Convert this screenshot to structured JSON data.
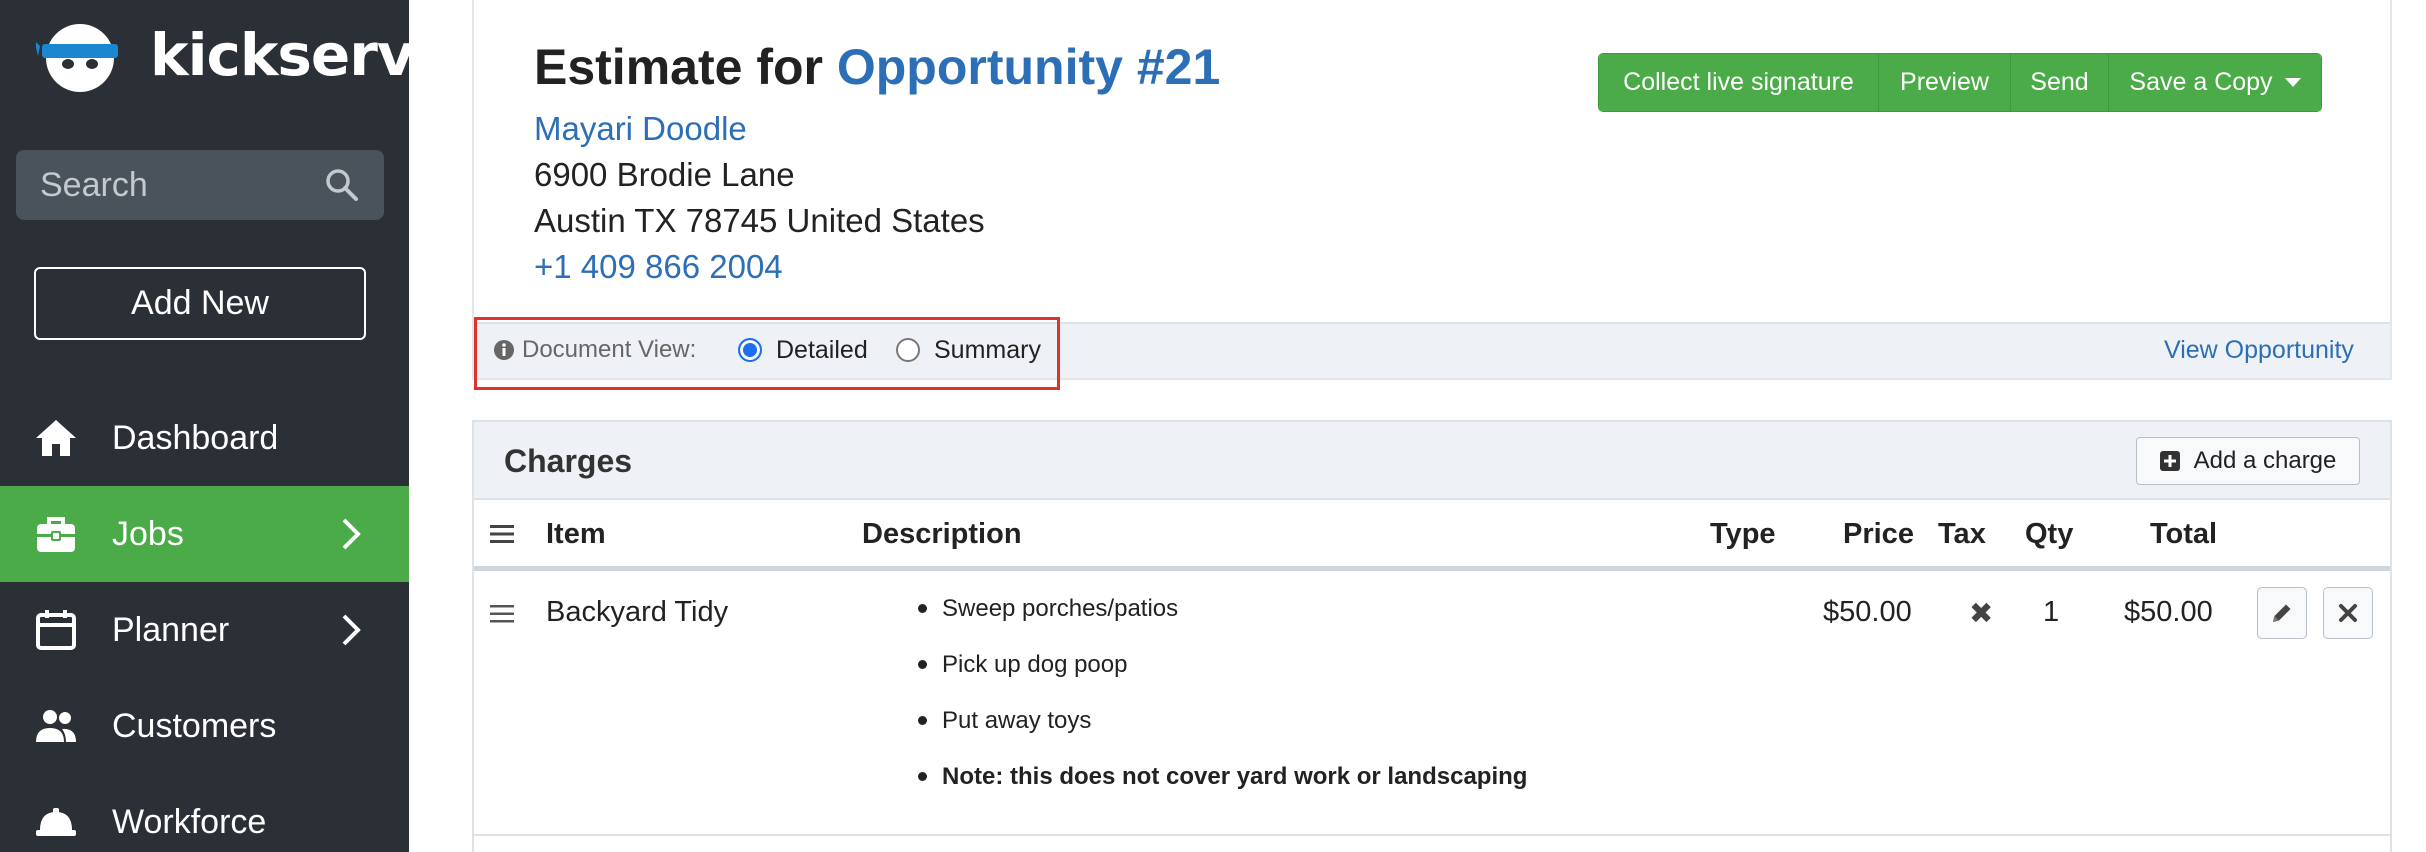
{
  "brand": {
    "name": "kickserv"
  },
  "sidebar": {
    "search_placeholder": "Search",
    "add_new_label": "Add New",
    "items": [
      {
        "label": "Dashboard",
        "icon": "home-icon"
      },
      {
        "label": "Jobs",
        "icon": "briefcase-icon",
        "active": true,
        "has_chevron": true
      },
      {
        "label": "Planner",
        "icon": "calendar-icon",
        "has_chevron": true
      },
      {
        "label": "Customers",
        "icon": "people-icon"
      },
      {
        "label": "Workforce",
        "icon": "hardhat-icon"
      }
    ]
  },
  "estimate": {
    "title_prefix": "Estimate for",
    "opportunity": "Opportunity #21",
    "customer_name": "Mayari Doodle",
    "address_line1": "6900 Brodie Lane",
    "address_line2": "Austin TX 78745 United States",
    "phone": "+1 409 866 2004"
  },
  "actions": {
    "collect_signature": "Collect live signature",
    "preview": "Preview",
    "send": "Send",
    "save_copy": "Save a Copy"
  },
  "document_view": {
    "label": "Document View:",
    "options": [
      "Detailed",
      "Summary"
    ],
    "selected": "Detailed",
    "view_opportunity": "View Opportunity"
  },
  "charges": {
    "title": "Charges",
    "add_label": "Add a charge",
    "columns": [
      "Item",
      "Description",
      "Type",
      "Price",
      "Tax",
      "Qty",
      "Total"
    ],
    "rows": [
      {
        "item": "Backyard Tidy",
        "description": [
          "Sweep porches/patios",
          "Pick up dog poop",
          "Put away toys",
          "Note: this does not cover yard work or landscaping"
        ],
        "type": "",
        "price": "$50.00",
        "tax": "✖",
        "qty": "1",
        "total": "$50.00"
      }
    ]
  },
  "colors": {
    "sidebar_bg": "#2b3036",
    "accent_green": "#4bab48",
    "link_blue": "#2c6fb6",
    "highlight_red": "#e0322c"
  }
}
